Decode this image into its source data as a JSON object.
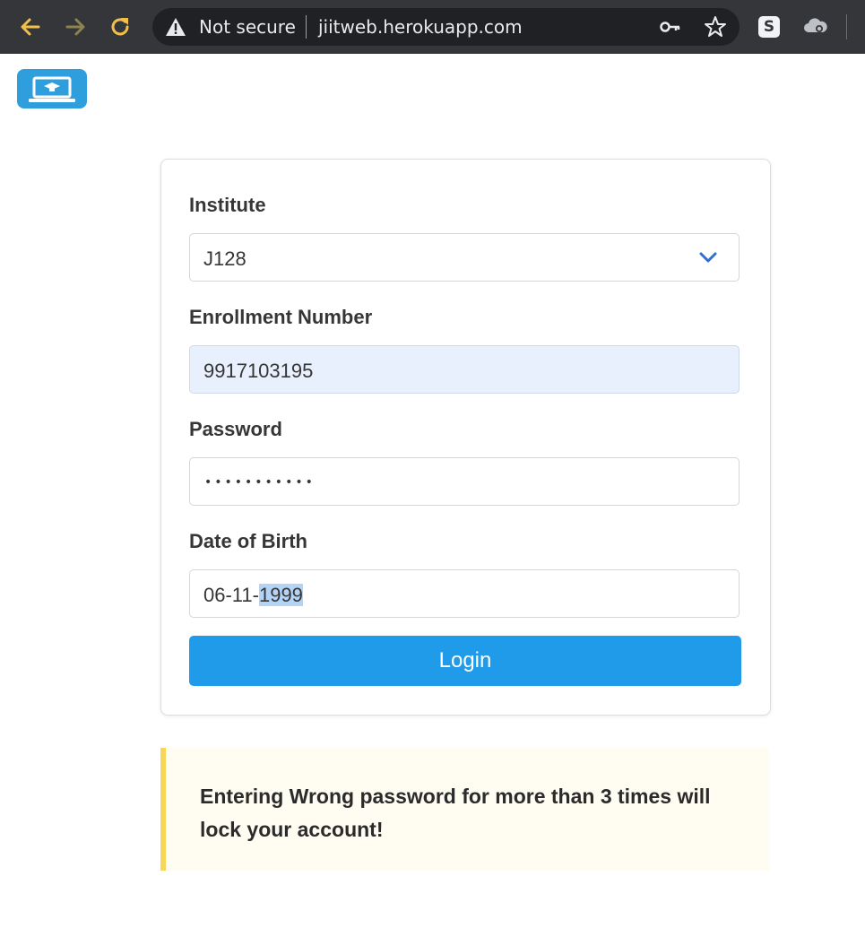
{
  "browser": {
    "security_label": "Not secure",
    "url": "jiitweb.herokuapp.com",
    "icons": {
      "back": "back-arrow-icon",
      "forward": "forward-arrow-icon",
      "reload": "reload-icon",
      "warning": "warning-icon",
      "key": "key-icon",
      "star": "star-icon",
      "extension_s": "extension-s-icon",
      "extension_cloud": "extension-cloud-icon"
    },
    "extension_s_letter": "S",
    "colors": {
      "chrome_bg": "#35363a",
      "nav_accent": "#f2c04a"
    }
  },
  "logo": {
    "icon": "laptop-graduation-icon",
    "color": "#2e9fdc"
  },
  "form": {
    "institute": {
      "label": "Institute",
      "value": "J128"
    },
    "enrollment": {
      "label": "Enrollment Number",
      "value": "9917103195"
    },
    "password": {
      "label": "Password",
      "masked_value": "•••••••••••"
    },
    "dob": {
      "label": "Date of Birth",
      "value_prefix": "06-11-",
      "value_selected": "1999"
    },
    "login_label": "Login",
    "colors": {
      "button": "#1f9bea",
      "autofill_bg": "#e8f0fe"
    }
  },
  "notice": {
    "text": "Entering Wrong password for more than 3 times will lock your account!",
    "colors": {
      "background": "#fffcf2",
      "border": "#f7d65a"
    }
  }
}
